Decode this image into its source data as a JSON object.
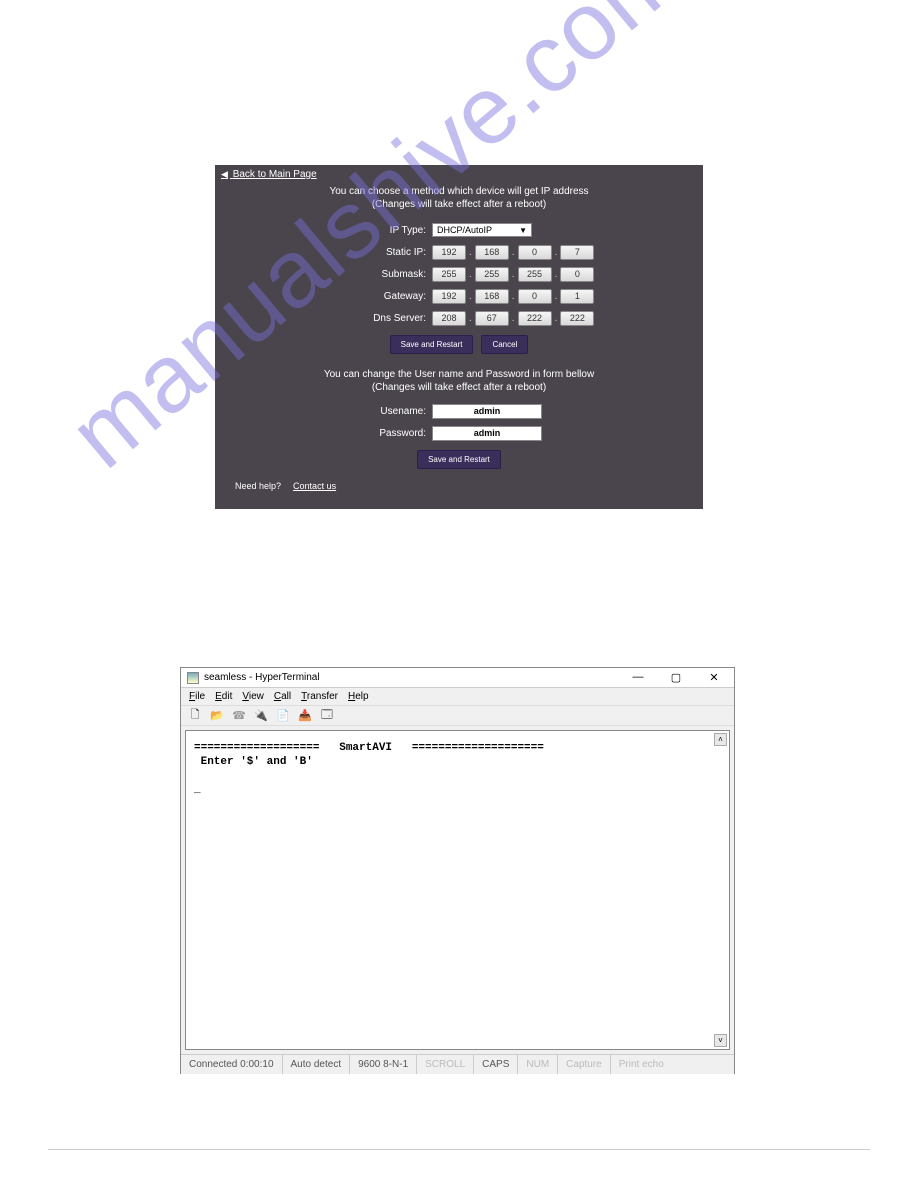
{
  "config": {
    "back_label": "Back to Main Page",
    "instr_top_1": "You can choose a method which device will get IP address",
    "instr_top_2": "(Changes will take effect after a reboot)",
    "ip_type_label": "IP Type:",
    "ip_type_value": "DHCP/AutoIP",
    "static_ip_label": "Static IP:",
    "static_ip": [
      "192",
      "168",
      "0",
      "7"
    ],
    "submask_label": "Submask:",
    "submask": [
      "255",
      "255",
      "255",
      "0"
    ],
    "gateway_label": "Gateway:",
    "gateway": [
      "192",
      "168",
      "0",
      "1"
    ],
    "dns_label": "Dns Server:",
    "dns": [
      "208",
      "67",
      "222",
      "222"
    ],
    "save_restart_label": "Save and Restart",
    "cancel_label": "Cancel",
    "instr_user_1": "You can change the User name and Password in form bellow",
    "instr_user_2": "(Changes will take effect after a reboot)",
    "username_label": "Usename:",
    "username_value": "admin",
    "password_label": "Password:",
    "password_value": "admin",
    "save_restart2_label": "Save and Restart",
    "help_label": "Need help?",
    "contact_label": "Contact us"
  },
  "hyperterminal": {
    "title": "seamless - HyperTerminal",
    "menu": {
      "file": "File",
      "edit": "Edit",
      "view": "View",
      "call": "Call",
      "transfer": "Transfer",
      "help": "Help"
    },
    "terminal": {
      "line1": "===================   SmartAVI   ====================",
      "line2": " Enter '$' and 'B'",
      "cursor": "_"
    },
    "status": {
      "connected": "Connected 0:00:10",
      "detect": "Auto detect",
      "baud": "9600 8-N-1",
      "scroll": "SCROLL",
      "caps": "CAPS",
      "num": "NUM",
      "capture": "Capture",
      "print": "Print echo"
    }
  },
  "watermark": "manualshive.com"
}
